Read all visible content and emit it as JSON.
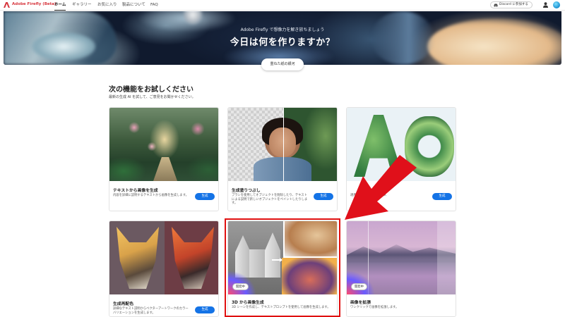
{
  "topbar": {
    "brand": "Adobe Firefly (Beta)",
    "nav": [
      "ホーム",
      "ギャラリー",
      "お気に入り",
      "製品について",
      "FAQ"
    ],
    "discord_label": "Discord に参加する",
    "icons": [
      "adobe-logo-icon",
      "discord-icon",
      "user-icon",
      "avatar"
    ]
  },
  "hero": {
    "subtitle": "Adobe Firefly で想像力を解き放ちましょう",
    "title": "今日は何を作りますか？",
    "gallery_button": "重ねた紙の銀河"
  },
  "section": {
    "title": "次の機能をお試しください",
    "description": "最新の生成 AI を試して、ご意見をお聞かせください。"
  },
  "cards": [
    {
      "title": "テキストから画像を生成",
      "description": "内容を詳細に説明するテキストから画像を生成します。",
      "button": "生成"
    },
    {
      "title": "生成塗りつぶし",
      "description": "ブラシを使用してオブジェクトを削除したり、テキストによる説明で新しいオブジェクトをペイントしたりします。",
      "button": "生成"
    },
    {
      "title": "",
      "description": "適用してスタイルやテクス",
      "button": "生成"
    },
    {
      "title": "生成再配色",
      "description": "詳細なテキスト説明からベクターアートワークのカラーバリエーションを生成します。",
      "button": "生成"
    },
    {
      "title": "3D から画像生成",
      "description": "3D シーンを作成し、テキストプロンプトを使用して画像を生成します。",
      "badge": "開発中"
    },
    {
      "title": "画像を拡張",
      "description": "ワンクリックで画像を拡張します。",
      "badge": "開発中"
    }
  ],
  "colors": {
    "accent": "#1473e6",
    "brand": "#d7373f",
    "highlight": "#e01010"
  }
}
